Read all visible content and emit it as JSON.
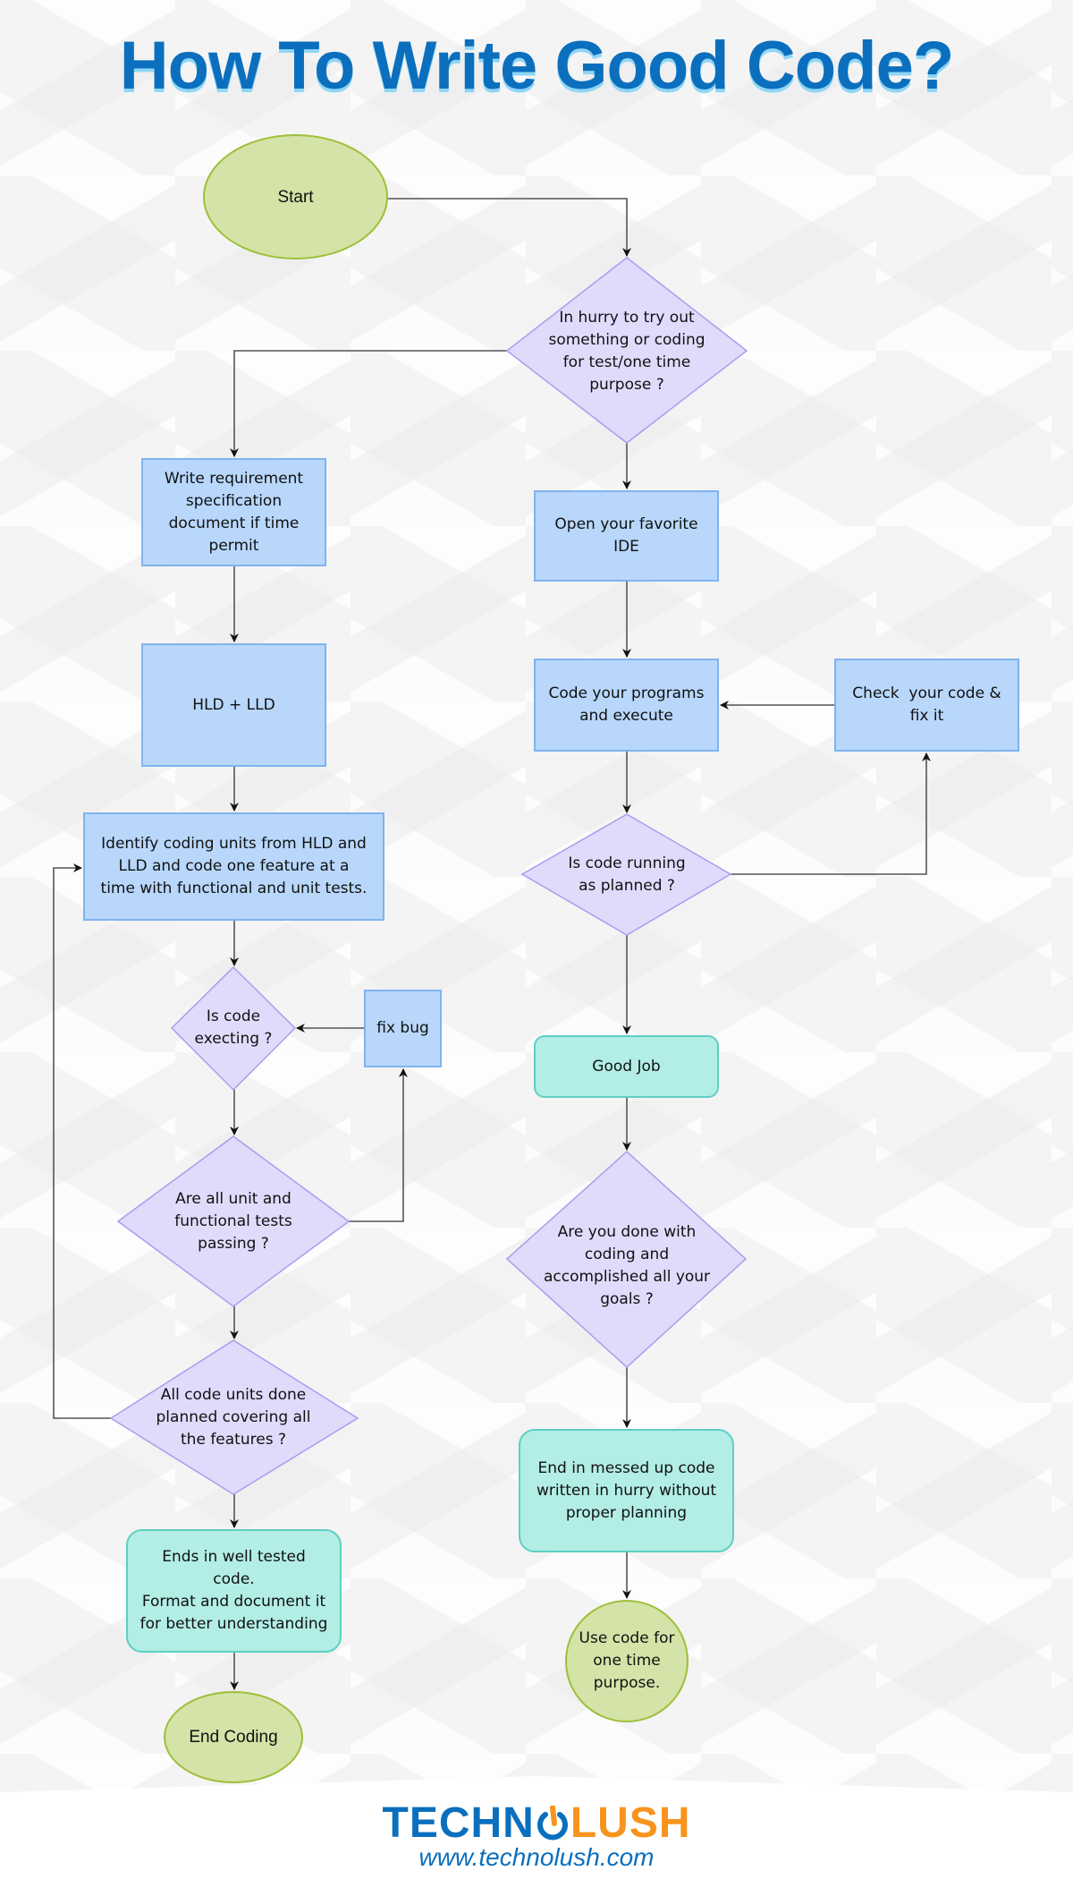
{
  "title": "How To Write Good Code?",
  "colors": {
    "title": "#0b6fbd",
    "process_fill": "#b8d7fb",
    "decision_fill": "#e0dbfb",
    "terminal_fill": "#d4e3a7",
    "end_state_fill": "#b2ede6",
    "logo_blue": "#0b6fbd",
    "logo_orange": "#f7941d"
  },
  "nodes": {
    "start": {
      "type": "terminal",
      "lines": [
        "Start"
      ]
    },
    "hurry_decision": {
      "type": "decision",
      "lines": [
        "In hurry to try out",
        "something or coding",
        "for test/one time",
        "purpose ?"
      ]
    },
    "write_requirements": {
      "type": "process",
      "lines": [
        "Write requirement",
        "specification",
        "document if time",
        "permit"
      ]
    },
    "hld_lld": {
      "type": "process",
      "lines": [
        "HLD + LLD"
      ]
    },
    "identify_units": {
      "type": "process",
      "lines": [
        "Identify coding units from HLD and",
        "LLD and code one feature at a",
        "time with functional and unit tests."
      ]
    },
    "code_executing": {
      "type": "decision",
      "lines": [
        "Is code",
        "execting ?"
      ]
    },
    "fix_bug": {
      "type": "process",
      "lines": [
        "fix bug"
      ]
    },
    "tests_passing": {
      "type": "decision",
      "lines": [
        "Are all unit and",
        "functional tests",
        "passing ?"
      ]
    },
    "all_units_done": {
      "type": "decision",
      "lines": [
        "All code units done",
        "planned covering all",
        "the features ?"
      ]
    },
    "well_tested": {
      "type": "end_state",
      "lines": [
        "Ends in well tested",
        "code.",
        "Format and document it",
        "for better understanding"
      ]
    },
    "end_coding": {
      "type": "terminal",
      "lines": [
        "End Coding"
      ]
    },
    "open_ide": {
      "type": "process",
      "lines": [
        "Open your favorite",
        "IDE"
      ]
    },
    "code_programs": {
      "type": "process",
      "lines": [
        "Code your programs",
        "and execute"
      ]
    },
    "check_code": {
      "type": "process",
      "lines": [
        "Check  your code &",
        "fix it"
      ]
    },
    "running_as_planned": {
      "type": "decision",
      "lines": [
        "Is code running",
        "as planned ?"
      ]
    },
    "good_job": {
      "type": "end_state",
      "lines": [
        "Good Job"
      ]
    },
    "done_with_goals": {
      "type": "decision",
      "lines": [
        "Are you done with",
        "coding and",
        "accomplished all your",
        "goals ?"
      ]
    },
    "messed_up": {
      "type": "end_state",
      "lines": [
        "End in messed up code",
        "written in hurry without",
        "proper planning"
      ]
    },
    "use_one_time": {
      "type": "terminal",
      "lines": [
        "Use code for",
        "one time",
        "purpose."
      ]
    }
  },
  "edges": [
    {
      "from": "start",
      "to": "hurry_decision"
    },
    {
      "from": "hurry_decision",
      "to": "write_requirements"
    },
    {
      "from": "hurry_decision",
      "to": "open_ide"
    },
    {
      "from": "write_requirements",
      "to": "hld_lld"
    },
    {
      "from": "hld_lld",
      "to": "identify_units"
    },
    {
      "from": "identify_units",
      "to": "code_executing"
    },
    {
      "from": "fix_bug",
      "to": "code_executing"
    },
    {
      "from": "code_executing",
      "to": "tests_passing"
    },
    {
      "from": "tests_passing",
      "to": "fix_bug"
    },
    {
      "from": "tests_passing",
      "to": "all_units_done"
    },
    {
      "from": "all_units_done",
      "to": "identify_units"
    },
    {
      "from": "all_units_done",
      "to": "well_tested"
    },
    {
      "from": "well_tested",
      "to": "end_coding"
    },
    {
      "from": "open_ide",
      "to": "code_programs"
    },
    {
      "from": "check_code",
      "to": "code_programs"
    },
    {
      "from": "code_programs",
      "to": "running_as_planned"
    },
    {
      "from": "running_as_planned",
      "to": "check_code"
    },
    {
      "from": "running_as_planned",
      "to": "good_job"
    },
    {
      "from": "good_job",
      "to": "done_with_goals"
    },
    {
      "from": "done_with_goals",
      "to": "messed_up"
    },
    {
      "from": "messed_up",
      "to": "use_one_time"
    }
  ],
  "footer": {
    "logo_left": "TECHN",
    "logo_right": "LUSH",
    "logo_icon": "power-icon",
    "url": "www.technolush.com"
  }
}
